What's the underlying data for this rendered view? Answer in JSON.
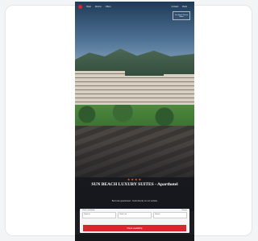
{
  "nav": {
    "links": [
      "Hotel",
      "Rooms",
      "Offers"
    ],
    "right_links": [
      "Contact",
      "Book"
    ]
  },
  "brand_badge": "Sun Beach Resort Suites",
  "hero": {
    "stars": "★★★★",
    "title": "SUN BEACH LUXURY SUITES - Aparthotel",
    "subtitle": "Best rate guaranteed - book directly on our website"
  },
  "booking": {
    "header_left": "Check availability",
    "header_right": "Rooms",
    "fields": [
      "Check in",
      "Check out",
      "Guests"
    ],
    "search_label": "Check availability"
  },
  "colors": {
    "accent": "#d9262c",
    "stars": "#e0712d"
  }
}
